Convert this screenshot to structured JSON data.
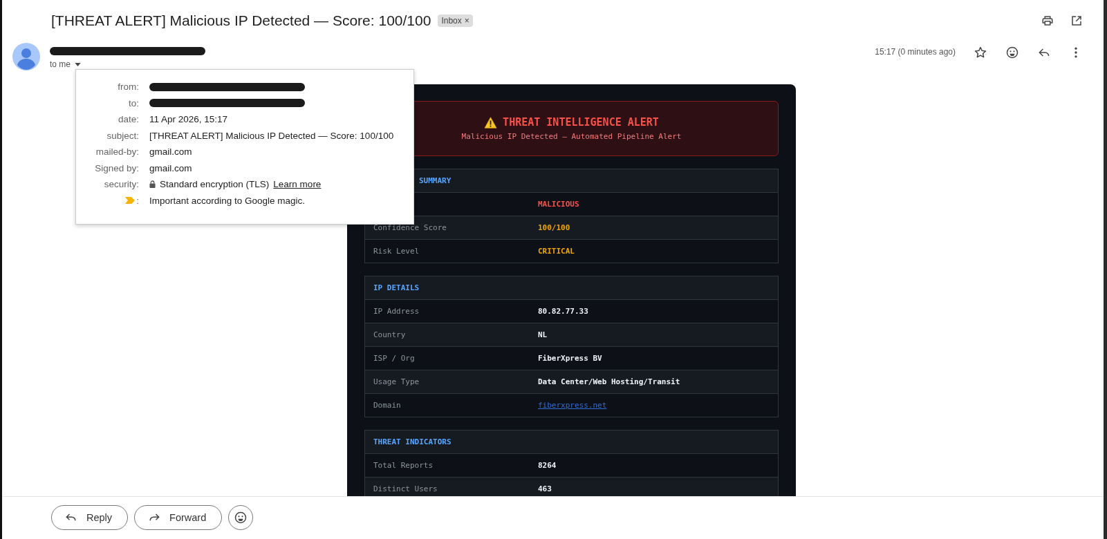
{
  "subject": "[THREAT ALERT] Malicious IP Detected — Score: 100/100",
  "label_chip": {
    "text": "Inbox",
    "remove": "×"
  },
  "recipient_line": "to me",
  "time": "15:17 (0 minutes ago)",
  "details_popup": {
    "rows": [
      {
        "kind": "redacted",
        "label": "from:"
      },
      {
        "kind": "redacted",
        "label": "to:"
      },
      {
        "kind": "text",
        "label": "date:",
        "value": "11 Apr 2026, 15:17"
      },
      {
        "kind": "text",
        "label": "subject:",
        "value": "[THREAT ALERT] Malicious IP Detected — Score: 100/100"
      },
      {
        "kind": "text",
        "label": "mailed-by:",
        "value": "gmail.com"
      },
      {
        "kind": "text",
        "label": "Signed by:",
        "value": "gmail.com"
      },
      {
        "kind": "security",
        "label": "security:",
        "value": "Standard encryption (TLS)",
        "link": "Learn more"
      },
      {
        "kind": "importance",
        "label": ":",
        "value": "Important according to Google magic."
      }
    ]
  },
  "alert": {
    "title": "THREAT INTELLIGENCE ALERT",
    "subtitle": "Malicious IP Detected — Automated Pipeline Alert"
  },
  "sections": [
    {
      "title": "SUMMARY",
      "rows": [
        {
          "kind": "text",
          "value": "MALICIOUS",
          "color": "#f85149"
        },
        {
          "kind": "text",
          "label": "Confidence Score",
          "value": "100/100",
          "color": "#f0a500"
        },
        {
          "kind": "text",
          "label": "Risk Level",
          "value": "CRITICAL",
          "color": "#f0a500"
        }
      ]
    },
    {
      "title": "IP DETAILS",
      "rows": [
        {
          "kind": "text",
          "label": "IP Address",
          "value": "80.82.77.33",
          "color": "#f0f3f6"
        },
        {
          "kind": "text",
          "label": "Country",
          "value": "NL",
          "color": "#f0f3f6"
        },
        {
          "kind": "text",
          "label": "ISP / Org",
          "value": "FiberXpress BV",
          "color": "#f0f3f6"
        },
        {
          "kind": "text",
          "label": "Usage Type",
          "value": "Data Center/Web Hosting/Transit",
          "color": "#f0f3f6"
        },
        {
          "kind": "link",
          "label": "Domain",
          "value": "fiberxpress.net"
        }
      ]
    },
    {
      "title": "THREAT INDICATORS",
      "rows": [
        {
          "kind": "text",
          "label": "Total Reports",
          "value": "8264",
          "color": "#f0f3f6"
        },
        {
          "kind": "text",
          "label": "Distinct Users",
          "value": "463",
          "color": "#f0f3f6"
        }
      ]
    }
  ],
  "footer_buttons": [
    {
      "kind": "reply",
      "label": "Reply"
    },
    {
      "kind": "forward",
      "label": "Forward"
    },
    {
      "kind": "emoji"
    }
  ]
}
